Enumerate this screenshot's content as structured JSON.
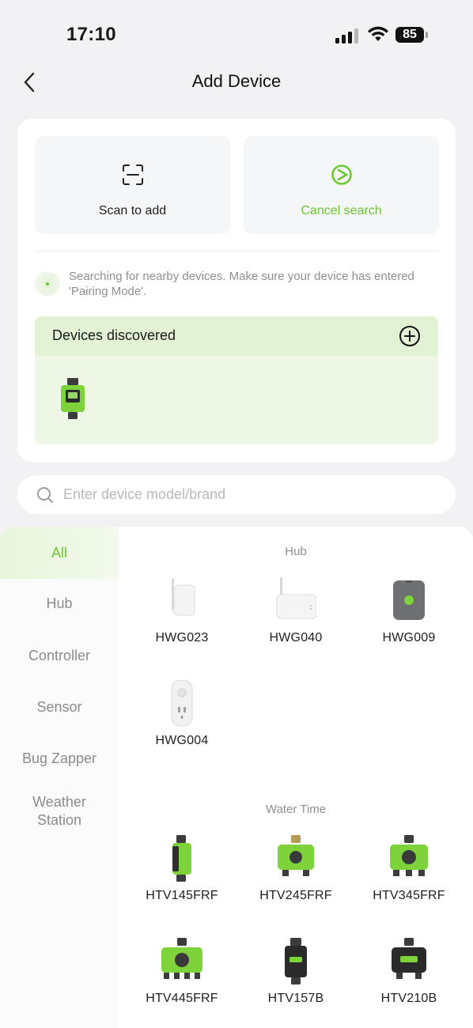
{
  "status_bar": {
    "time": "17:10",
    "battery": "85"
  },
  "header": {
    "title": "Add Device"
  },
  "actions": {
    "scan_label": "Scan to add",
    "cancel_label": "Cancel search"
  },
  "search_hint": "Searching for nearby devices. Make sure your device has entered 'Pairing Mode'.",
  "discovered": {
    "title": "Devices discovered"
  },
  "search": {
    "placeholder": "Enter device model/brand"
  },
  "sidebar": {
    "items": [
      {
        "label": "All"
      },
      {
        "label": "Hub"
      },
      {
        "label": "Controller"
      },
      {
        "label": "Sensor"
      },
      {
        "label": "Bug Zapper"
      },
      {
        "label": "Weather Station"
      }
    ]
  },
  "sections": [
    {
      "title": "Hub",
      "devices": [
        {
          "model": "HWG023"
        },
        {
          "model": "HWG040"
        },
        {
          "model": "HWG009"
        },
        {
          "model": "HWG004"
        }
      ]
    },
    {
      "title": "Water Time",
      "devices": [
        {
          "model": "HTV145FRF"
        },
        {
          "model": "HTV245FRF"
        },
        {
          "model": "HTV345FRF"
        },
        {
          "model": "HTV445FRF"
        },
        {
          "model": "HTV157B"
        },
        {
          "model": "HTV210B"
        }
      ]
    }
  ],
  "colors": {
    "accent": "#6cc82f",
    "background": "#f2f2f4"
  }
}
